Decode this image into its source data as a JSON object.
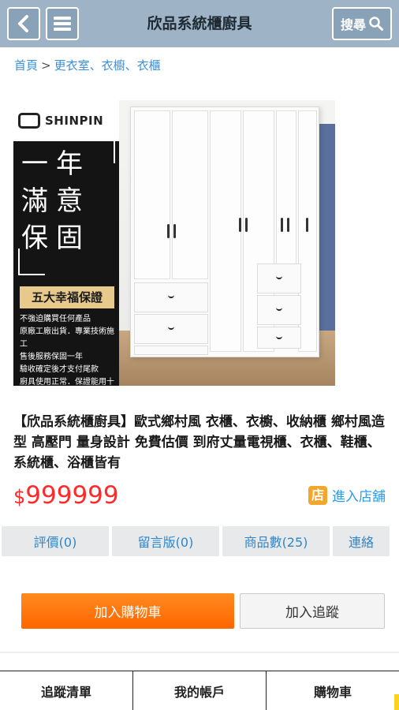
{
  "header": {
    "title": "欣品系統櫃廚具",
    "search_label": "搜尋",
    "icons": [
      "chevron-left-icon",
      "hamburger-menu-icon",
      "search-icon"
    ]
  },
  "breadcrumb": {
    "home": "首頁",
    "separator": ">",
    "category": "更衣室、衣櫥、衣櫃"
  },
  "product_image": {
    "brand": "SHINPIN",
    "slogan_lines": [
      "一年",
      "滿意",
      "保固"
    ],
    "guarantee_label": "五大幸福保證",
    "promise_lines": [
      "不強迫購買任何產品",
      "原廠工廠出貨．專業技術施工",
      "售後服務保固一年",
      "驗收確定後才支付尾款",
      "廚具使用正常．保證能用十年"
    ]
  },
  "product": {
    "title": "【欣品系統櫃廚具】歐式鄉村風 衣櫃、衣櫥、收納櫃 鄉村風造型 高壓門 量身設計 免費估價 到府丈量電視櫃、衣櫃、鞋櫃、系統櫃、浴櫃皆有",
    "currency_symbol": "$",
    "price": "999999",
    "store_icon_char": "店",
    "store_link_label": "進入店舖"
  },
  "tabs": [
    {
      "label": "評價(0)"
    },
    {
      "label": "留言版(0)"
    },
    {
      "label": "商品數(25)"
    },
    {
      "label": "連絡"
    }
  ],
  "actions": {
    "add_to_cart": "加入購物車",
    "add_to_tracking": "加入追蹤"
  },
  "bottom_nav": [
    {
      "label": "追蹤清單"
    },
    {
      "label": "我的帳戶"
    },
    {
      "label": "購物車"
    }
  ],
  "colors": {
    "header_bg": "#9eb3c6",
    "link": "#3a8fd6",
    "price": "#ff2a2a",
    "cart_button": "#ff7a10",
    "store_icon": "#f3a62c"
  }
}
